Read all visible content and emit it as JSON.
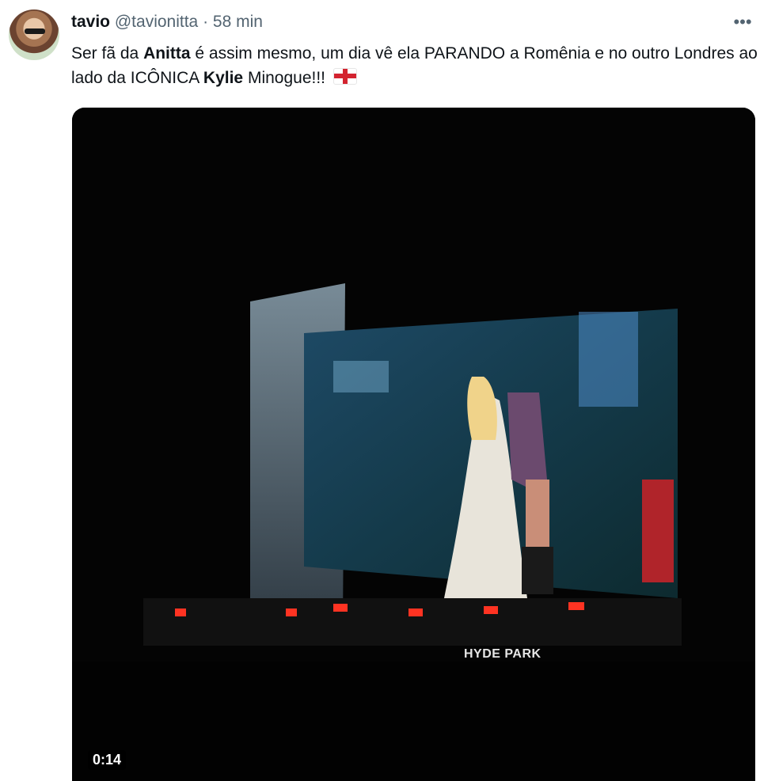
{
  "user": {
    "name": "tavio",
    "handle": "@tavionitta",
    "separator": "·",
    "time": "58 min"
  },
  "tweet": {
    "t1": "Ser fã da ",
    "b1": "Anitta",
    "t2": " é assim mesmo, um dia vê ela PARANDO a Romênia e no outro Londres ao lado da ICÔNICA ",
    "b2": "Kylie",
    "t3": " Minogue!!! ",
    "flag_icon": "england-flag-icon"
  },
  "video": {
    "duration": "0:14",
    "stage_sign": "HYDE PARK"
  },
  "icons": {
    "more": "more-options-icon"
  }
}
